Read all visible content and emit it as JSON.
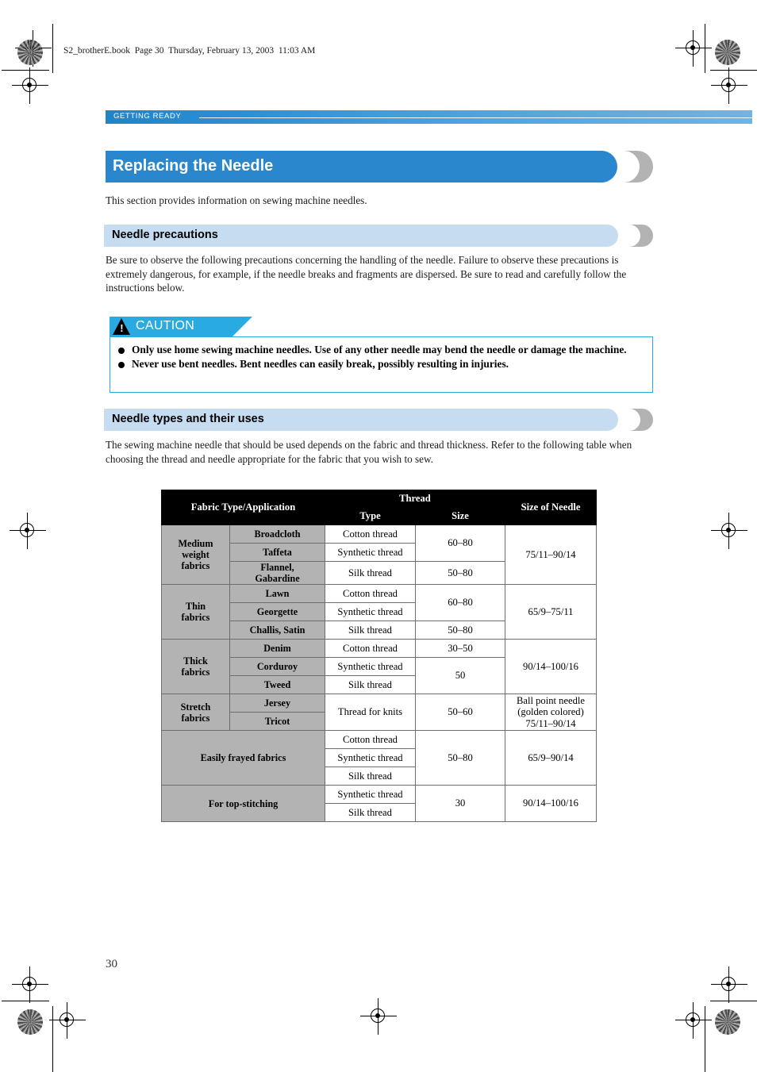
{
  "print_marks": {
    "file_line": "S2_brotherE.book  Page 30  Thursday, February 13, 2003  11:03 AM"
  },
  "running_header": {
    "label": "GETTING READY"
  },
  "title": {
    "text": "Replacing the Needle",
    "intro": "This section provides information on sewing machine needles."
  },
  "sections": [
    {
      "heading": "Needle precautions",
      "body": "Be sure to observe the following precautions concerning the handling of the needle. Failure to observe these precautions is extremely dangerous, for example, if the needle breaks and fragments are dispersed. Be sure to read and carefully follow the instructions below."
    },
    {
      "heading": "Needle types and their uses",
      "body": "The sewing machine needle that should be used depends on the fabric and thread thickness. Refer to the following table when choosing the thread and needle appropriate for the fabric that you wish to sew."
    }
  ],
  "caution": {
    "label": "CAUTION",
    "symbol": "!",
    "items": [
      "Only use home sewing machine needles. Use of any other needle may bend the needle or damage the machine.",
      "Never use bent needles. Bent needles can easily break, possibly resulting in injuries."
    ]
  },
  "table": {
    "headers": {
      "fabric": "Fabric Type/Application",
      "thread": "Thread",
      "type": "Type",
      "size": "Size",
      "needle": "Size of Needle"
    },
    "groups": [
      {
        "name": "Medium\nweight\nfabrics",
        "needle": "75/11–90/14",
        "rows": [
          {
            "sub": "Broadcloth",
            "type": "Cotton thread",
            "size": "60–80",
            "size_span": 2
          },
          {
            "sub": "Taffeta",
            "type": "Synthetic thread"
          },
          {
            "sub": "Flannel,\nGabardine",
            "type": "Silk thread",
            "size": "50–80",
            "size_span": 1
          }
        ]
      },
      {
        "name": "Thin\nfabrics",
        "needle": "65/9–75/11",
        "rows": [
          {
            "sub": "Lawn",
            "type": "Cotton thread",
            "size": "60–80",
            "size_span": 2
          },
          {
            "sub": "Georgette",
            "type": "Synthetic thread"
          },
          {
            "sub": "Challis, Satin",
            "type": "Silk thread",
            "size": "50–80",
            "size_span": 1
          }
        ]
      },
      {
        "name": "Thick\nfabrics",
        "needle": "90/14–100/16",
        "rows": [
          {
            "sub": "Denim",
            "type": "Cotton thread",
            "size": "30–50",
            "size_span": 1
          },
          {
            "sub": "Corduroy",
            "type": "Synthetic thread",
            "size": "50",
            "size_span": 2
          },
          {
            "sub": "Tweed",
            "type": "Silk thread"
          }
        ]
      },
      {
        "name": "Stretch\nfabrics",
        "needle": "Ball point needle\n(golden colored)\n75/11–90/14",
        "rows": [
          {
            "sub": "Jersey",
            "type": "Thread for knits",
            "type_span": 2,
            "size": "50–60",
            "size_span": 2
          },
          {
            "sub": "Tricot"
          }
        ]
      },
      {
        "name": "Easily frayed fabrics",
        "wide": true,
        "needle": "65/9–90/14",
        "rows": [
          {
            "type": "Cotton thread",
            "size": "50–80",
            "size_span": 3
          },
          {
            "type": "Synthetic thread"
          },
          {
            "type": "Silk thread"
          }
        ]
      },
      {
        "name": "For top-stitching",
        "wide": true,
        "needle": "90/14–100/16",
        "rows": [
          {
            "type": "Synthetic thread",
            "size": "30",
            "size_span": 2
          },
          {
            "type": "Silk thread"
          }
        ]
      }
    ]
  },
  "footer": {
    "page_number": "30"
  },
  "colors": {
    "title_blue": "#2b87cd",
    "sub_blue": "#c6dcf1",
    "caution_blue": "#29abe2",
    "header_black": "#000000",
    "group_gray": "#b3b3b3"
  }
}
